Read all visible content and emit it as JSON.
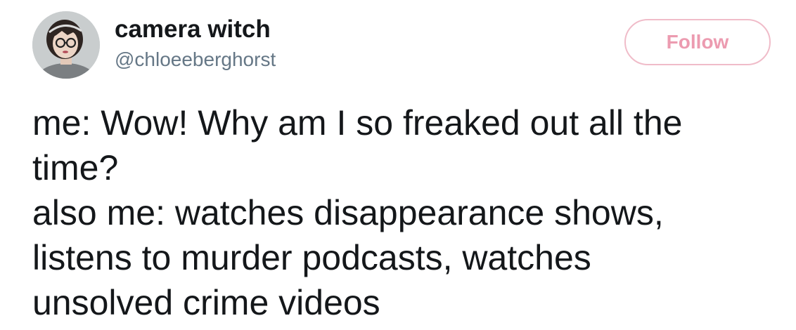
{
  "author": {
    "display_name": "camera witch",
    "handle": "@chloeeberghorst",
    "avatar_icon": "user-avatar-photo"
  },
  "follow_button": {
    "label": "Follow",
    "border_color": "#f0bcc9",
    "text_color": "#ec9bb0"
  },
  "tweet": {
    "lines": [
      "me: Wow! Why am I so freaked out all the",
      "time?",
      "also me: watches disappearance shows,",
      "listens to murder podcasts, watches",
      "unsolved crime videos"
    ]
  },
  "colors": {
    "text": "#14171a",
    "secondary_text": "#657786"
  }
}
